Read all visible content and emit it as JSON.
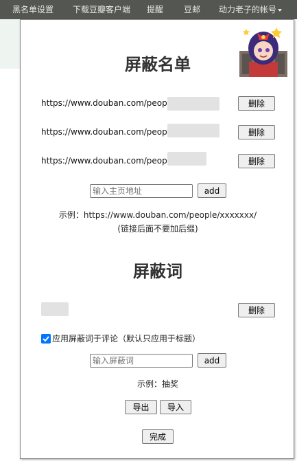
{
  "nav": {
    "items": [
      "黑名单设置",
      "下载豆瓣客户端",
      "提醒",
      "豆邮"
    ],
    "account": "动力老子的帐号"
  },
  "blacklist": {
    "title": "屏蔽名单",
    "entries": [
      {
        "url": "https://www.douban.com/people"
      },
      {
        "url": "https://www.douban.com/people"
      },
      {
        "url": "https://www.douban.com/people"
      }
    ],
    "delete_label": "删除",
    "input_placeholder": "输入主页地址",
    "add_label": "add",
    "example": "示例：https://www.douban.com/people/xxxxxxx/",
    "example_note": "(链接后面不要加后缀)"
  },
  "keywords": {
    "title": "屏蔽词",
    "delete_label": "删除",
    "apply_to_comments_label": "应用屏蔽词于评论（默认只应用于标题）",
    "apply_to_comments_checked": true,
    "input_placeholder": "输入屏蔽词",
    "add_label": "add",
    "example": "示例：抽奖"
  },
  "actions": {
    "export_label": "导出",
    "import_label": "导入",
    "done_label": "完成"
  },
  "colors": {
    "nav_bg": "#545652",
    "checkbox": "#0075ff"
  }
}
